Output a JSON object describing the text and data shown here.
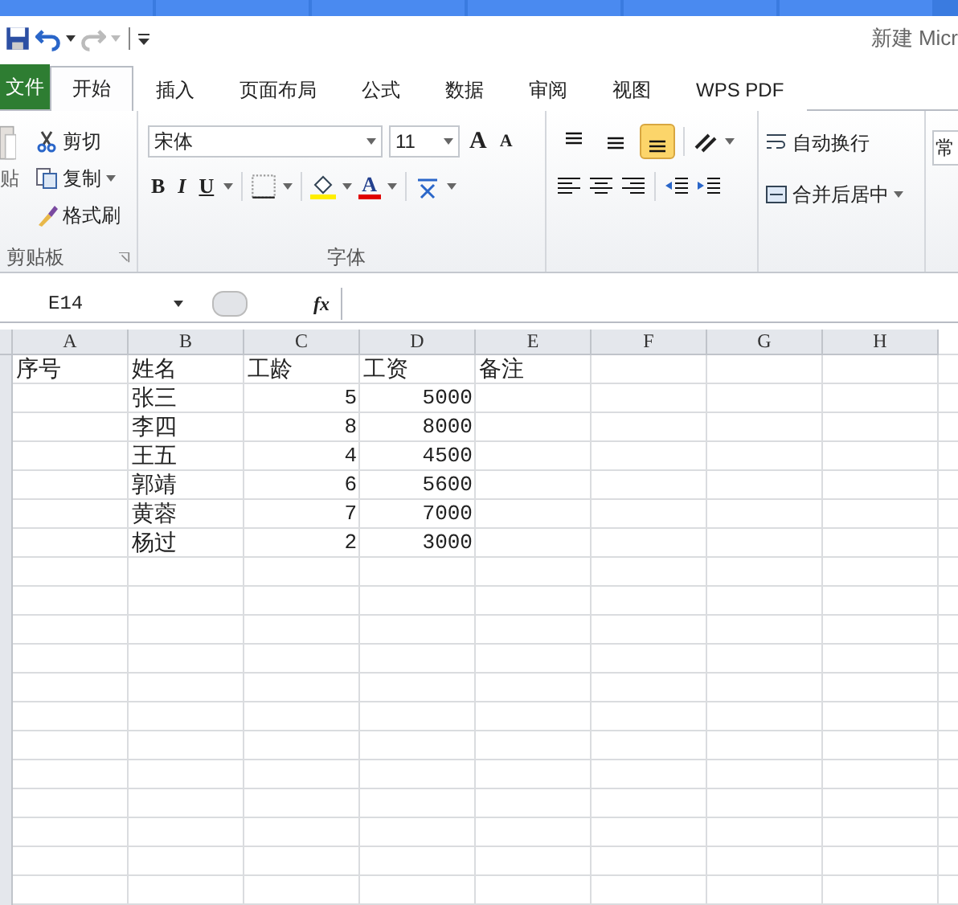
{
  "title": "新建 Micr",
  "ribbon_tabs": [
    {
      "label": "文件",
      "kind": "file",
      "selected": false
    },
    {
      "label": "开始",
      "kind": "tab",
      "selected": true
    },
    {
      "label": "插入",
      "kind": "tab",
      "selected": false
    },
    {
      "label": "页面布局",
      "kind": "tab",
      "selected": false
    },
    {
      "label": "公式",
      "kind": "tab",
      "selected": false
    },
    {
      "label": "数据",
      "kind": "tab",
      "selected": false
    },
    {
      "label": "审阅",
      "kind": "tab",
      "selected": false
    },
    {
      "label": "视图",
      "kind": "tab",
      "selected": false
    },
    {
      "label": "WPS PDF",
      "kind": "tab",
      "selected": false
    }
  ],
  "clipboard": {
    "paste_label": "贴",
    "cut": "剪切",
    "copy": "复制",
    "format_painter": "格式刷",
    "group_label": "剪贴板"
  },
  "font": {
    "name": "宋体",
    "size": "11",
    "grow": "A",
    "shrink": "A",
    "bold": "B",
    "italic": "I",
    "underline": "U",
    "font_color": "A",
    "group_label": "字体"
  },
  "alignment": {
    "vertical": [
      {
        "selected": false
      },
      {
        "selected": false
      },
      {
        "selected": true
      }
    ],
    "wrap_text": "自动换行",
    "merge_center": "合并后居中"
  },
  "number_format": "常",
  "name_box": "E14",
  "function_label": "fx",
  "sheet": {
    "columns": [
      "A",
      "B",
      "C",
      "D",
      "E",
      "F",
      "G",
      "H"
    ],
    "rows": [
      [
        {
          "text": "序号",
          "kind": "text"
        },
        {
          "text": "姓名",
          "kind": "text"
        },
        {
          "text": "工龄",
          "kind": "text"
        },
        {
          "text": "工资",
          "kind": "text"
        },
        {
          "text": "备注",
          "kind": "text"
        }
      ],
      [
        {
          "text": ""
        },
        {
          "text": "张三",
          "kind": "text"
        },
        {
          "text": "5",
          "kind": "number"
        },
        {
          "text": "5000",
          "kind": "number"
        }
      ],
      [
        {
          "text": ""
        },
        {
          "text": "李四",
          "kind": "text"
        },
        {
          "text": "8",
          "kind": "number"
        },
        {
          "text": "8000",
          "kind": "number"
        }
      ],
      [
        {
          "text": ""
        },
        {
          "text": "王五",
          "kind": "text"
        },
        {
          "text": "4",
          "kind": "number"
        },
        {
          "text": "4500",
          "kind": "number"
        }
      ],
      [
        {
          "text": ""
        },
        {
          "text": "郭靖",
          "kind": "text"
        },
        {
          "text": "6",
          "kind": "number"
        },
        {
          "text": "5600",
          "kind": "number"
        }
      ],
      [
        {
          "text": ""
        },
        {
          "text": "黄蓉",
          "kind": "text"
        },
        {
          "text": "7",
          "kind": "number"
        },
        {
          "text": "7000",
          "kind": "number"
        }
      ],
      [
        {
          "text": ""
        },
        {
          "text": "杨过",
          "kind": "text"
        },
        {
          "text": "2",
          "kind": "number"
        },
        {
          "text": "3000",
          "kind": "number"
        }
      ]
    ]
  }
}
